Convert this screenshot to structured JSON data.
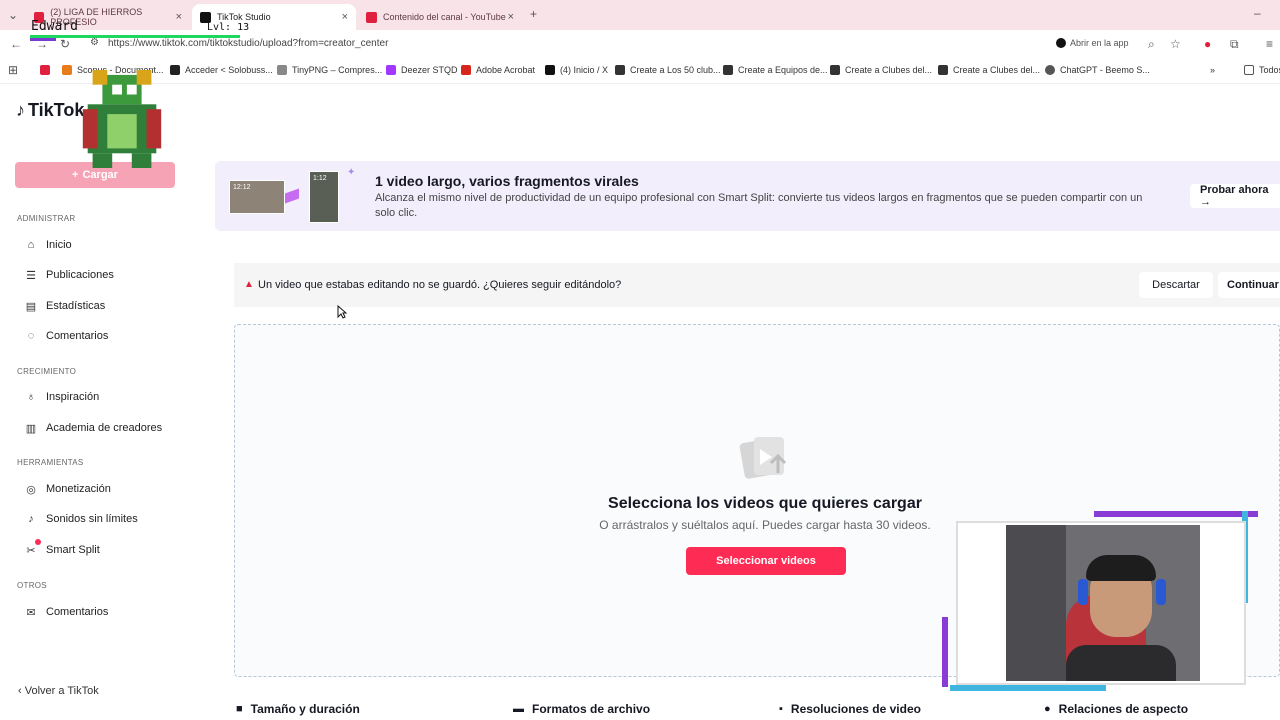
{
  "browser": {
    "tabs": [
      {
        "title": "(2) LIGA DE HIERROS PROFESIO",
        "favicon": "youtube-icon",
        "color": "#e0203f"
      },
      {
        "title": "TikTok Studio",
        "favicon": "tiktok-icon",
        "color": "#111111"
      },
      {
        "title": "Contenido del canal - YouTube",
        "favicon": "youtube-icon",
        "color": "#e0203f"
      }
    ],
    "url": "https://www.tiktok.com/tiktokstudio/upload?from=creator_center",
    "open_app_label": "Abrir en la app",
    "bookmarks": [
      "Scopus - Document...",
      "Acceder < Solobuss...",
      "TinyPNG – Compres...",
      "Deezer STQD",
      "Adobe Acrobat",
      "(4) Inicio / X",
      "Create a Los 50 club...",
      "Create a Equipos de...",
      "Create a Clubes del...",
      "Create a Clubes del...",
      "ChatGPT - Beemo S...",
      "Todos"
    ]
  },
  "overlay": {
    "name": "Edward",
    "level": "Lvl: 13"
  },
  "sidebar": {
    "logo": "TikTok",
    "upload_label": "Cargar",
    "sections": [
      {
        "title": "ADMINISTRAR",
        "items": [
          {
            "label": "Inicio",
            "icon": "home-icon"
          },
          {
            "label": "Publicaciones",
            "icon": "list-icon"
          },
          {
            "label": "Estadísticas",
            "icon": "chart-icon"
          },
          {
            "label": "Comentarios",
            "icon": "comment-icon"
          }
        ]
      },
      {
        "title": "CRECIMIENTO",
        "items": [
          {
            "label": "Inspiración",
            "icon": "bulb-icon"
          },
          {
            "label": "Academia de creadores",
            "icon": "academy-icon"
          }
        ]
      },
      {
        "title": "HERRAMIENTAS",
        "items": [
          {
            "label": "Monetización",
            "icon": "money-icon"
          },
          {
            "label": "Sonidos sin límites",
            "icon": "music-icon"
          },
          {
            "label": "Smart Split",
            "icon": "scissors-icon"
          }
        ]
      },
      {
        "title": "OTROS",
        "items": [
          {
            "label": "Comentarios",
            "icon": "mail-icon"
          }
        ]
      }
    ],
    "back_label": "Volver a TikTok"
  },
  "banner": {
    "thumb1_time": "12:12",
    "thumb2_time": "1:12",
    "title": "1 video largo, varios fragmentos virales",
    "description": "Alcanza el mismo nivel de productividad de un equipo profesional con Smart Split: convierte tus videos largos en fragmentos que se pueden compartir con un solo clic.",
    "cta": "Probar ahora →"
  },
  "warning": {
    "text": "Un video que estabas editando no se guardó. ¿Quieres seguir editándolo?",
    "discard": "Descartar",
    "continue": "Continuar"
  },
  "dropzone": {
    "title": "Selecciona los videos que quieres cargar",
    "subtitle": "O arrástralos y suéltalos aquí. Puedes cargar hasta 30 videos.",
    "button": "Seleccionar videos"
  },
  "features": [
    {
      "label": "Tamaño y duración",
      "icon": "video-icon"
    },
    {
      "label": "Formatos de archivo",
      "icon": "file-icon"
    },
    {
      "label": "Resoluciones de video",
      "icon": "hd-icon"
    },
    {
      "label": "Relaciones de aspecto",
      "icon": "aspect-icon"
    }
  ],
  "colors": {
    "accent": "#fe2c55",
    "accent_disabled": "#f7a3b6",
    "banner_bg": "#f2eefc"
  }
}
